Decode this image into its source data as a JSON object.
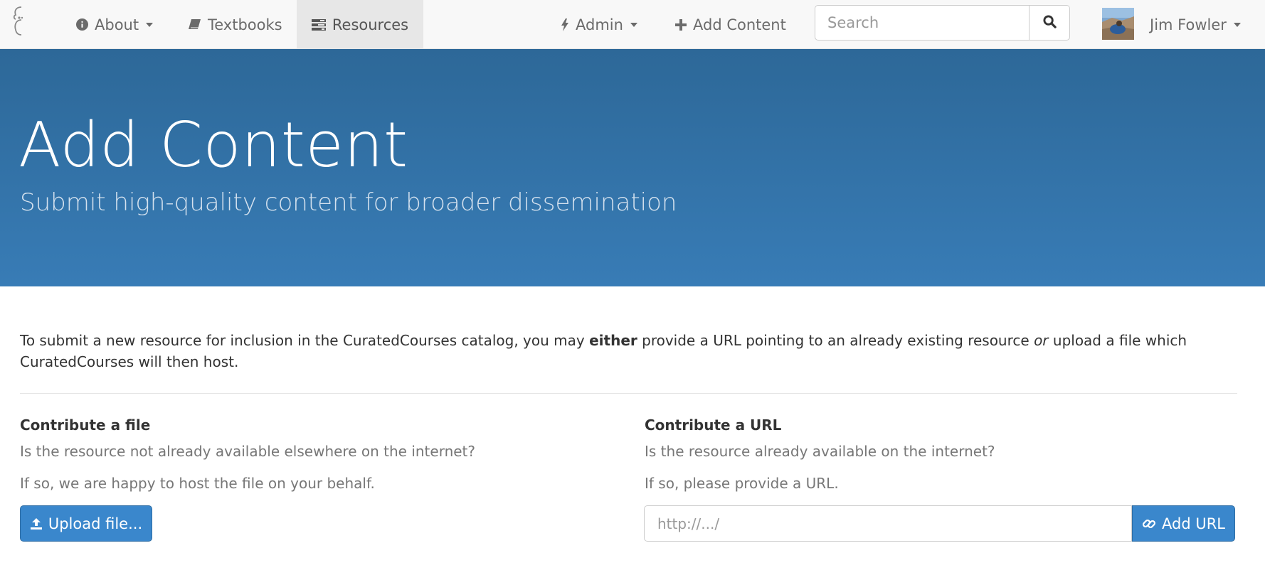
{
  "navbar": {
    "items": [
      {
        "label": "About",
        "icon": "info-circle-icon",
        "dropdown": true
      },
      {
        "label": "Textbooks",
        "icon": "book-icon",
        "dropdown": false
      },
      {
        "label": "Resources",
        "icon": "tasks-icon",
        "dropdown": false,
        "active": true
      },
      {
        "label": "Admin",
        "icon": "bolt-icon",
        "dropdown": true
      },
      {
        "label": "Add Content",
        "icon": "plus-icon",
        "dropdown": false
      }
    ],
    "search_placeholder": "Search",
    "user_name": "Jim Fowler"
  },
  "hero": {
    "title": "Add Content",
    "subtitle": "Submit high-quality content for broader dissemination"
  },
  "intro": {
    "part1": "To submit a new resource for inclusion in the CuratedCourses catalog, you may ",
    "bold": "either",
    "part2": " provide a URL pointing to an already existing resource ",
    "italic": "or",
    "part3": " upload a file which CuratedCourses will then host."
  },
  "file_section": {
    "heading": "Contribute a file",
    "question": "Is the resource not already available elsewhere on the internet?",
    "note": "If so, we are happy to host the file on your behalf.",
    "button_label": "Upload file..."
  },
  "url_section": {
    "heading": "Contribute a URL",
    "question": "Is the resource already available on the internet?",
    "note": "If so, please provide a URL.",
    "input_placeholder": "http://.../",
    "button_label": "Add URL"
  },
  "colors": {
    "hero_top": "#2d6898",
    "hero_bottom": "#387cb6",
    "primary": "#3a87cc",
    "navbar_bg": "#f8f8f8"
  }
}
